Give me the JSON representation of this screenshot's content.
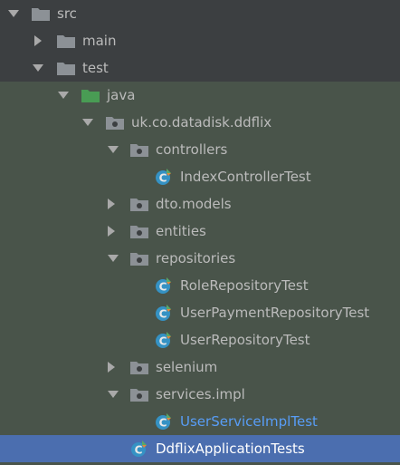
{
  "colors": {
    "background": "#3c3f41",
    "test_region": "#49544a",
    "selection": "#4b6eaf",
    "text": "#bbbbbb",
    "open_file_text": "#589df6",
    "folder": "#8c9196",
    "source_folder": "#499c54",
    "class_icon": "#3592c4"
  },
  "tree": {
    "src": {
      "label": "src",
      "icon": "folder-icon",
      "expanded": true
    },
    "main": {
      "label": "main",
      "icon": "folder-icon",
      "expanded": false
    },
    "test": {
      "label": "test",
      "icon": "folder-icon",
      "expanded": true
    },
    "java": {
      "label": "java",
      "icon": "test-source-folder-icon",
      "expanded": true
    },
    "package": {
      "label": "uk.co.datadisk.ddflix",
      "icon": "package-icon",
      "expanded": true
    },
    "controllers": {
      "label": "controllers",
      "icon": "package-icon",
      "expanded": true
    },
    "index_controller_test": {
      "label": "IndexControllerTest",
      "icon": "class-icon"
    },
    "dto_models": {
      "label": "dto.models",
      "icon": "package-icon",
      "expanded": false
    },
    "entities": {
      "label": "entities",
      "icon": "package-icon",
      "expanded": false
    },
    "repositories": {
      "label": "repositories",
      "icon": "package-icon",
      "expanded": true
    },
    "role_repository_test": {
      "label": "RoleRepositoryTest",
      "icon": "class-icon"
    },
    "user_payment_repository_test": {
      "label": "UserPaymentRepositoryTest",
      "icon": "class-icon"
    },
    "user_repository_test": {
      "label": "UserRepositoryTest",
      "icon": "class-icon"
    },
    "selenium": {
      "label": "selenium",
      "icon": "package-icon",
      "expanded": false
    },
    "services_impl": {
      "label": "services.impl",
      "icon": "package-icon",
      "expanded": true
    },
    "user_service_impl_test": {
      "label": "UserServiceImplTest",
      "icon": "class-icon"
    },
    "ddflix_application_tests": {
      "label": "DdflixApplicationTests",
      "icon": "class-icon",
      "selected": true
    }
  }
}
